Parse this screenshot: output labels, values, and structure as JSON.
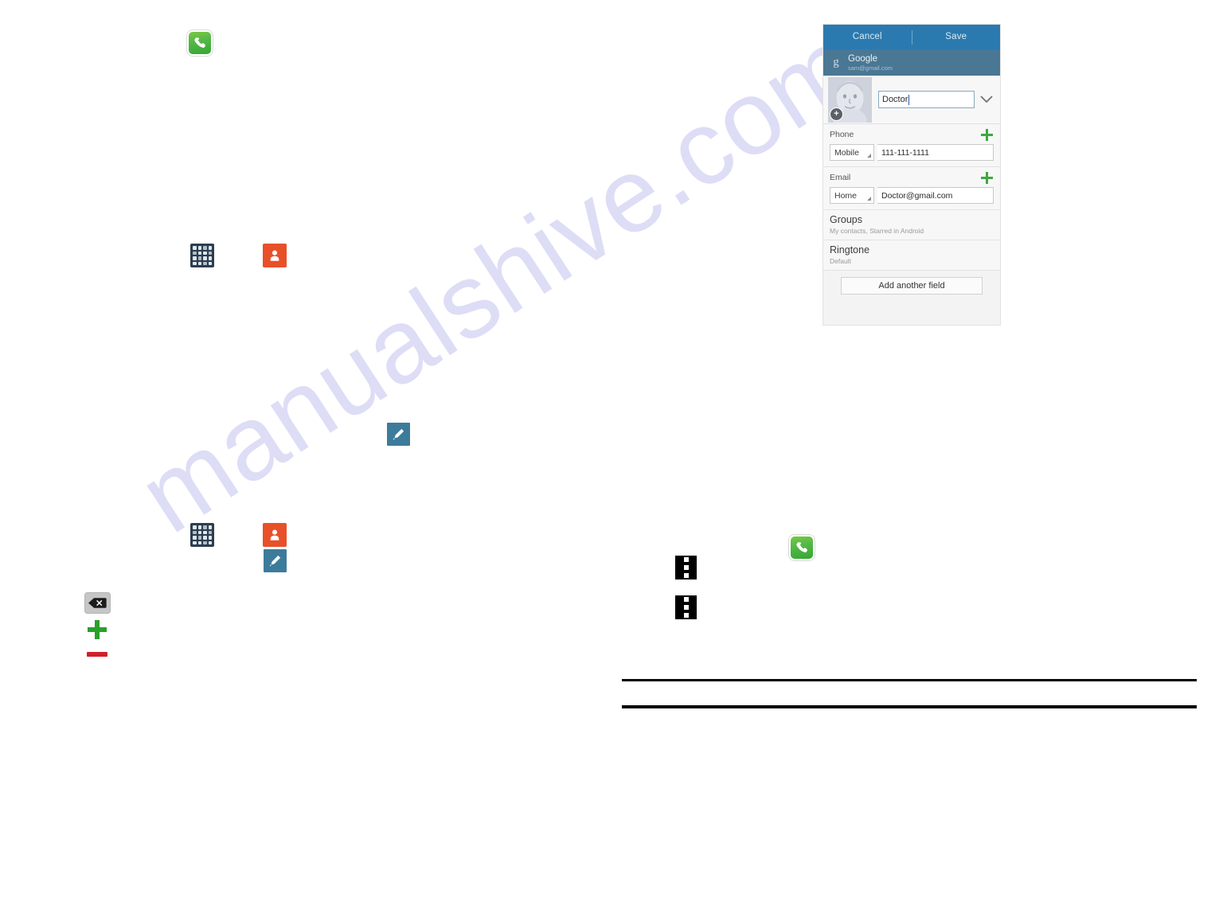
{
  "page": {
    "background": "#ffffff",
    "watermark": "manualshive.com",
    "watermark_color": "#c9c9f2"
  },
  "icons": {
    "phone_top": "phone-icon",
    "apps_grid_1": "apps-grid-icon",
    "contacts_1": "contacts-icon",
    "edit_pencil_1": "edit-pencil-icon",
    "apps_grid_2": "apps-grid-icon",
    "contacts_2": "contacts-icon",
    "edit_pencil_2": "edit-pencil-icon",
    "backspace": "backspace-icon",
    "plus": "plus-icon",
    "minus": "minus-icon",
    "overflow_1": "overflow-menu-icon",
    "overflow_2": "overflow-menu-icon",
    "phone_right": "phone-icon"
  },
  "colors": {
    "phone_green": "#56b947",
    "contacts_orange": "#e8502a",
    "edit_blue": "#3d7b9b",
    "apps_dark": "#2c3e50",
    "plus_green": "#2aa02a",
    "minus_red": "#d0202a",
    "actionbar_blue": "#2a7ab0",
    "account_blue": "#4a7794"
  },
  "phone_panel": {
    "actionbar": {
      "cancel_label": "Cancel",
      "save_label": "Save"
    },
    "account": {
      "provider": "Google",
      "mark": "g",
      "email": "sam@gmail.com"
    },
    "name_row": {
      "name_value": "Doctor",
      "expand_icon": "chevron-down-icon",
      "avatar_badge": "+"
    },
    "phone_section": {
      "label": "Phone",
      "add_icon": "plus-icon",
      "type": "Mobile",
      "value": "111-111-1111"
    },
    "email_section": {
      "label": "Email",
      "add_icon": "plus-icon",
      "type": "Home",
      "value": "Doctor@gmail.com"
    },
    "groups_row": {
      "title": "Groups",
      "subtitle": "My contacts, Starred in Android"
    },
    "ringtone_row": {
      "title": "Ringtone",
      "subtitle": "Default"
    },
    "footer": {
      "add_another_field_label": "Add another field"
    }
  }
}
